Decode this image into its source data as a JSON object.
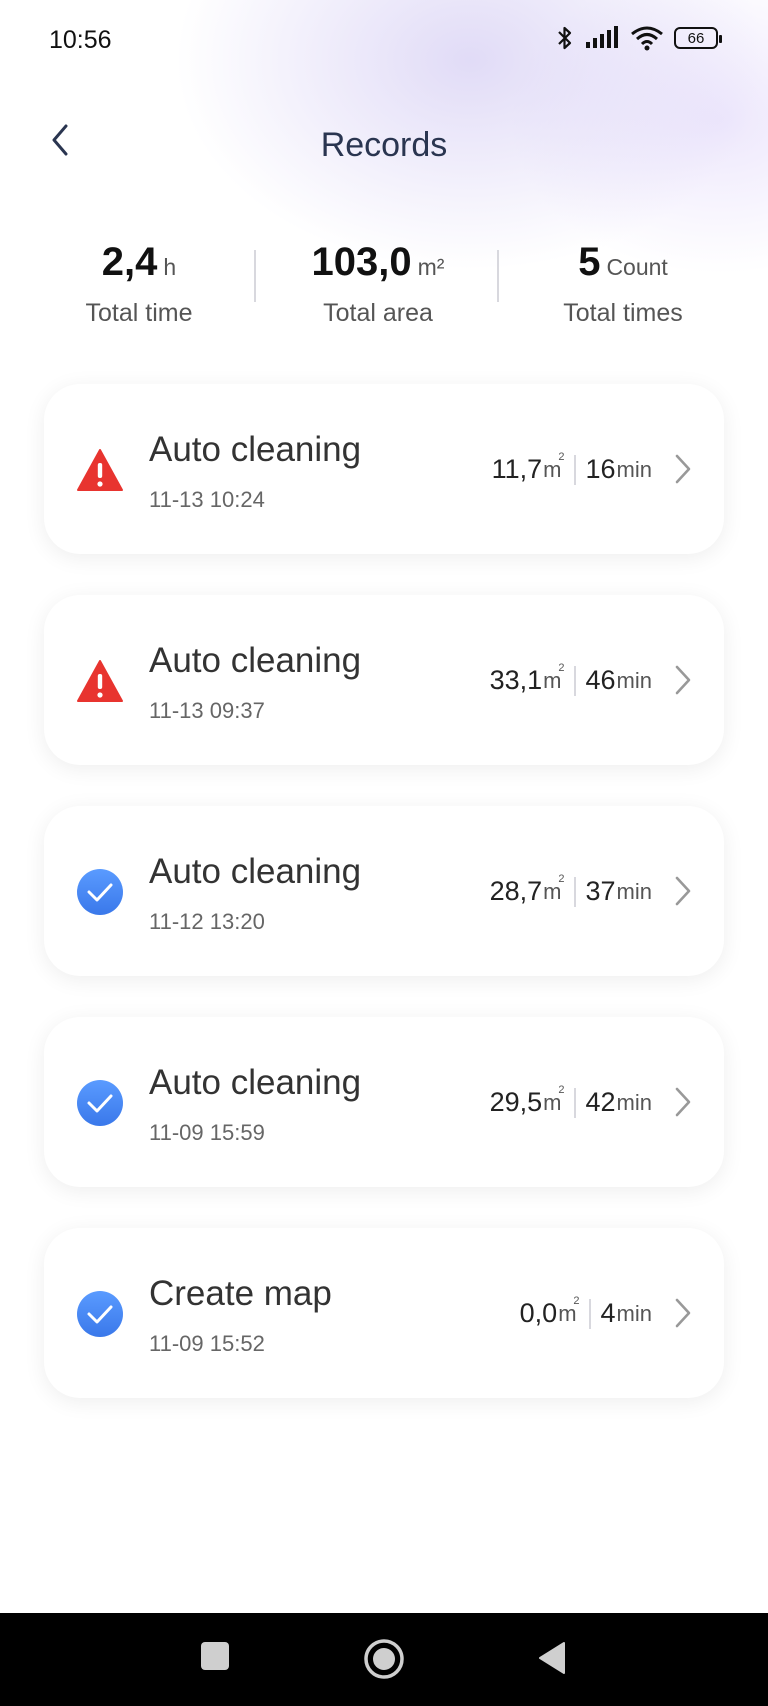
{
  "status_bar": {
    "time": "10:56",
    "battery": "66"
  },
  "header": {
    "title": "Records"
  },
  "summary": {
    "total_time": {
      "value": "2,4",
      "unit": "h",
      "label": "Total time"
    },
    "total_area": {
      "value": "103,0",
      "unit": "m²",
      "label": "Total area"
    },
    "total_times": {
      "value": "5",
      "unit": "Count",
      "label": "Total times"
    }
  },
  "records": [
    {
      "title": "Auto cleaning",
      "date": "11-13 10:24",
      "area": "11,7",
      "duration": "16",
      "status": "warning"
    },
    {
      "title": "Auto cleaning",
      "date": "11-13 09:37",
      "area": "33,1",
      "duration": "46",
      "status": "warning"
    },
    {
      "title": "Auto cleaning",
      "date": "11-12 13:20",
      "area": "28,7",
      "duration": "37",
      "status": "success"
    },
    {
      "title": "Auto cleaning",
      "date": "11-09 15:59",
      "area": "29,5",
      "duration": "42",
      "status": "success"
    },
    {
      "title": "Create map",
      "date": "11-09 15:52",
      "area": "0,0",
      "duration": "4",
      "status": "success"
    }
  ],
  "units": {
    "area": "m",
    "area_sup": "2",
    "duration": "min"
  },
  "colors": {
    "warning": "#e8342f",
    "success": "#4d8df5",
    "title": "#2a3550"
  }
}
